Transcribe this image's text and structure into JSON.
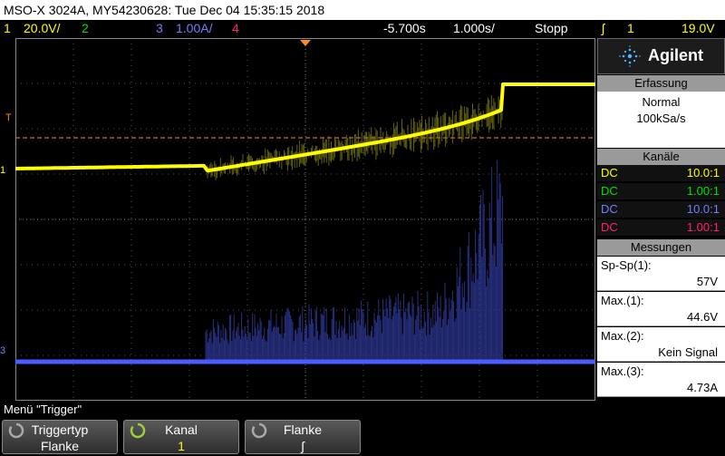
{
  "title": "MSO-X 3024A, MY54230628: Tue Dec 04 15:35:15 2018",
  "status": {
    "ch1_num": "1",
    "ch1_scale": "20.0V/",
    "ch2_num": "2",
    "ch3_num": "3",
    "ch3_scale": "1.00A/",
    "ch4_num": "4",
    "delay": "-5.700s",
    "timebase": "1.000s/",
    "run_state": "Stopp",
    "trig_icon": "edge-trigger-icon",
    "trig_src": "1",
    "trig_level": "19.0V"
  },
  "markers": {
    "trigger": "T",
    "ch1": "1",
    "ch3": "3"
  },
  "brand": {
    "name": "Agilent"
  },
  "erfassung": {
    "heading": "Erfassung",
    "mode": "Normal",
    "rate": "100kSa/s"
  },
  "kanaele": {
    "heading": "Kanäle",
    "rows": [
      {
        "coupling": "DC",
        "ratio": "10.0:1",
        "color": "#ffff00"
      },
      {
        "coupling": "DC",
        "ratio": "1.00:1",
        "color": "#00e000"
      },
      {
        "coupling": "DC",
        "ratio": "10.0:1",
        "color": "#6f7fff"
      },
      {
        "coupling": "DC",
        "ratio": "1.00:1",
        "color": "#ff2070"
      }
    ]
  },
  "messungen": {
    "heading": "Messungen",
    "items": [
      {
        "label": "Sp-Sp(1):",
        "value": "57V"
      },
      {
        "label": "Max.(1):",
        "value": "44.6V"
      },
      {
        "label": "Max.(2):",
        "value": "Kein Signal"
      },
      {
        "label": "Max.(3):",
        "value": "4.73A"
      }
    ]
  },
  "menu": {
    "label": "Menü \"Trigger\"",
    "softkeys": [
      {
        "top": "Triggertyp",
        "bottom": "Flanke",
        "icon": "knob-icon"
      },
      {
        "top": "Kanal",
        "bottom": "1",
        "icon": "knob-icon"
      },
      {
        "top": "Flanke",
        "bottom": "ʃ",
        "icon": "knob-icon"
      }
    ]
  },
  "colors": {
    "ch1": "#ffff00",
    "ch2": "#00e000",
    "ch3": "#5a6bff",
    "ch4": "#ff2070",
    "trigger_line": "#ff8c1a"
  }
}
